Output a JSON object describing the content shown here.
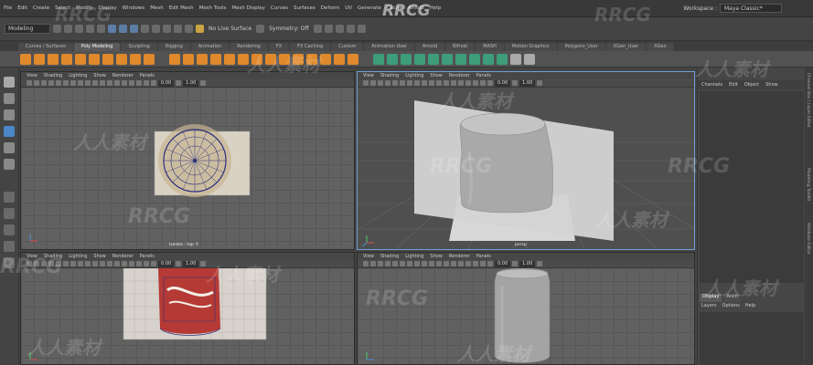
{
  "menubar": {
    "items": [
      "File",
      "Edit",
      "Create",
      "Select",
      "Modify",
      "Display",
      "Windows",
      "Mesh",
      "Edit Mesh",
      "Mesh Tools",
      "Mesh Display",
      "Curves",
      "Surfaces",
      "Deform",
      "UV",
      "Generate",
      "Cache",
      "Arnold",
      "Help"
    ],
    "workspace_label": "Workspace :",
    "workspace_value": "Maya Classic*"
  },
  "statusline": {
    "mode": "Modeling",
    "surface": "No Live Surface",
    "symmetry": "Symmetry: Off"
  },
  "shelf_tabs": [
    "Curves / Surfaces",
    "Poly Modeling",
    "Sculpting",
    "Rigging",
    "Animation",
    "Rendering",
    "FX",
    "FX Caching",
    "Custom",
    "Animation User",
    "Arnold",
    "Bifrost",
    "MASH",
    "Motion Graphics",
    "Polygons_User",
    "XGen_User",
    "XGen"
  ],
  "shelf_active": "Poly Modeling",
  "viewport_menu": [
    "View",
    "Shading",
    "Lighting",
    "Show",
    "Renderer",
    "Panels"
  ],
  "viewport_values": {
    "near": "0.00",
    "far": "1.00"
  },
  "viewports": {
    "top_left_label": "Isolate : top -Y",
    "top_right_label": "persp"
  },
  "channel_box": {
    "menu": [
      "Channels",
      "Edit",
      "Object",
      "Show"
    ],
    "layer_tabs": [
      "Display",
      "Anim"
    ],
    "layer_menu": [
      "Layers",
      "Options",
      "Help"
    ]
  },
  "side_tabs": [
    "Channel Box / Layer Editor",
    "Modeling Toolkit",
    "Attribute Editor"
  ],
  "watermark": {
    "brand": "RRCG",
    "cn": "人人素材"
  },
  "colors": {
    "active_viewport": "#6fa0d8",
    "shelf_orange": "#e0892c",
    "shelf_green": "#3d9d7a",
    "can_red": "#b53a35"
  },
  "icons": {
    "toolbox": [
      "select-arrow-icon",
      "lasso-icon",
      "paint-select-icon",
      "move-icon",
      "rotate-icon",
      "scale-icon",
      "layout-single-icon",
      "layout-four-icon"
    ]
  }
}
